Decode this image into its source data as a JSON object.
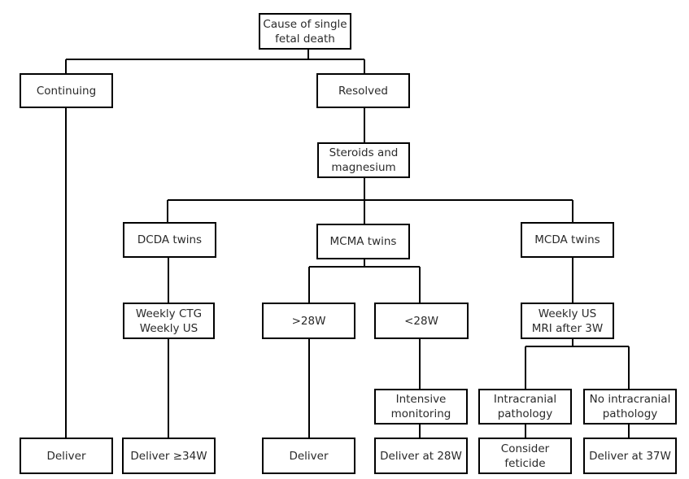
{
  "diagram": {
    "type": "flowchart",
    "nodes": {
      "root": "Cause of single\nfetal death",
      "continuing": "Continuing",
      "resolved": "Resolved",
      "steroids": "Steroids and\nmagnesium",
      "dcda": "DCDA twins",
      "mcma": "MCMA twins",
      "mcda": "MCDA twins",
      "dcda_monitor": "Weekly CTG\nWeekly US",
      "mcma_gt28": ">28W",
      "mcma_lt28": "<28W",
      "mcda_monitor": "Weekly US\nMRI after 3W",
      "intensive": "Intensive\nmonitoring",
      "intracranial": "Intracranial\npathology",
      "no_intracranial": "No intracranial\npathology",
      "deliver_continuing": "Deliver",
      "deliver_dcda": "Deliver ≥34W",
      "deliver_gt28": "Deliver",
      "deliver_28": "Deliver at 28W",
      "feticide": "Consider\nfeticide",
      "deliver_37": "Deliver at 37W"
    },
    "edges": [
      [
        "root",
        "continuing"
      ],
      [
        "root",
        "resolved"
      ],
      [
        "continuing",
        "deliver_continuing"
      ],
      [
        "resolved",
        "steroids"
      ],
      [
        "steroids",
        "dcda"
      ],
      [
        "steroids",
        "mcma"
      ],
      [
        "steroids",
        "mcda"
      ],
      [
        "dcda",
        "dcda_monitor"
      ],
      [
        "dcda_monitor",
        "deliver_dcda"
      ],
      [
        "mcma",
        "mcma_gt28"
      ],
      [
        "mcma",
        "mcma_lt28"
      ],
      [
        "mcma_gt28",
        "deliver_gt28"
      ],
      [
        "mcma_lt28",
        "intensive"
      ],
      [
        "intensive",
        "deliver_28"
      ],
      [
        "mcda",
        "mcda_monitor"
      ],
      [
        "mcda_monitor",
        "intracranial"
      ],
      [
        "mcda_monitor",
        "no_intracranial"
      ],
      [
        "intracranial",
        "feticide"
      ],
      [
        "no_intracranial",
        "deliver_37"
      ]
    ]
  }
}
